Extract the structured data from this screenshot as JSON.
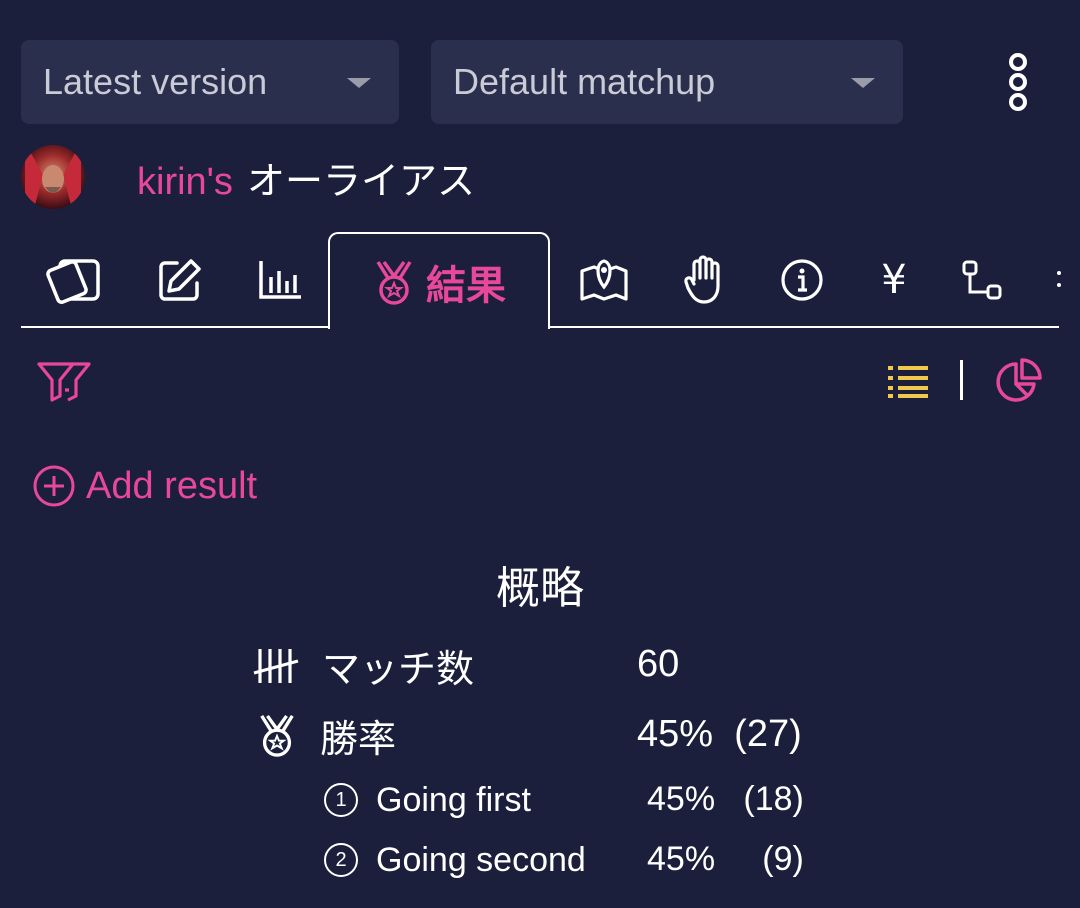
{
  "toolbar": {
    "version_select": "Latest version",
    "matchup_select": "Default matchup",
    "more_icon": "kebab-menu-icon"
  },
  "deck": {
    "owner": "kirin's",
    "name": "オーライアス"
  },
  "tabs": [
    {
      "icon": "cards-icon",
      "label": ""
    },
    {
      "icon": "edit-icon",
      "label": ""
    },
    {
      "icon": "bar-chart-icon",
      "label": ""
    },
    {
      "icon": "medal-icon",
      "label": "結果",
      "active": true
    },
    {
      "icon": "map-icon",
      "label": ""
    },
    {
      "icon": "hand-icon",
      "label": ""
    },
    {
      "icon": "info-icon",
      "label": ""
    },
    {
      "icon": "yen-icon",
      "label": "¥"
    },
    {
      "icon": "flow-icon",
      "label": ""
    }
  ],
  "actions": {
    "add_result": "Add result"
  },
  "summary": {
    "title": "概略",
    "matches_label": "マッチ数",
    "matches_value": "60",
    "winrate_label": "勝率",
    "winrate_value": "45%  (27)",
    "first_num": "1",
    "first_label": "Going first",
    "first_value": "45%   (18)",
    "second_num": "2",
    "second_label": "Going second",
    "second_value": "45%     (9)"
  },
  "colors": {
    "background": "#1b1f3b",
    "accent": "#e8489a",
    "list_icon": "#f2c84b",
    "dropdown_bg": "#2a2f4d"
  }
}
